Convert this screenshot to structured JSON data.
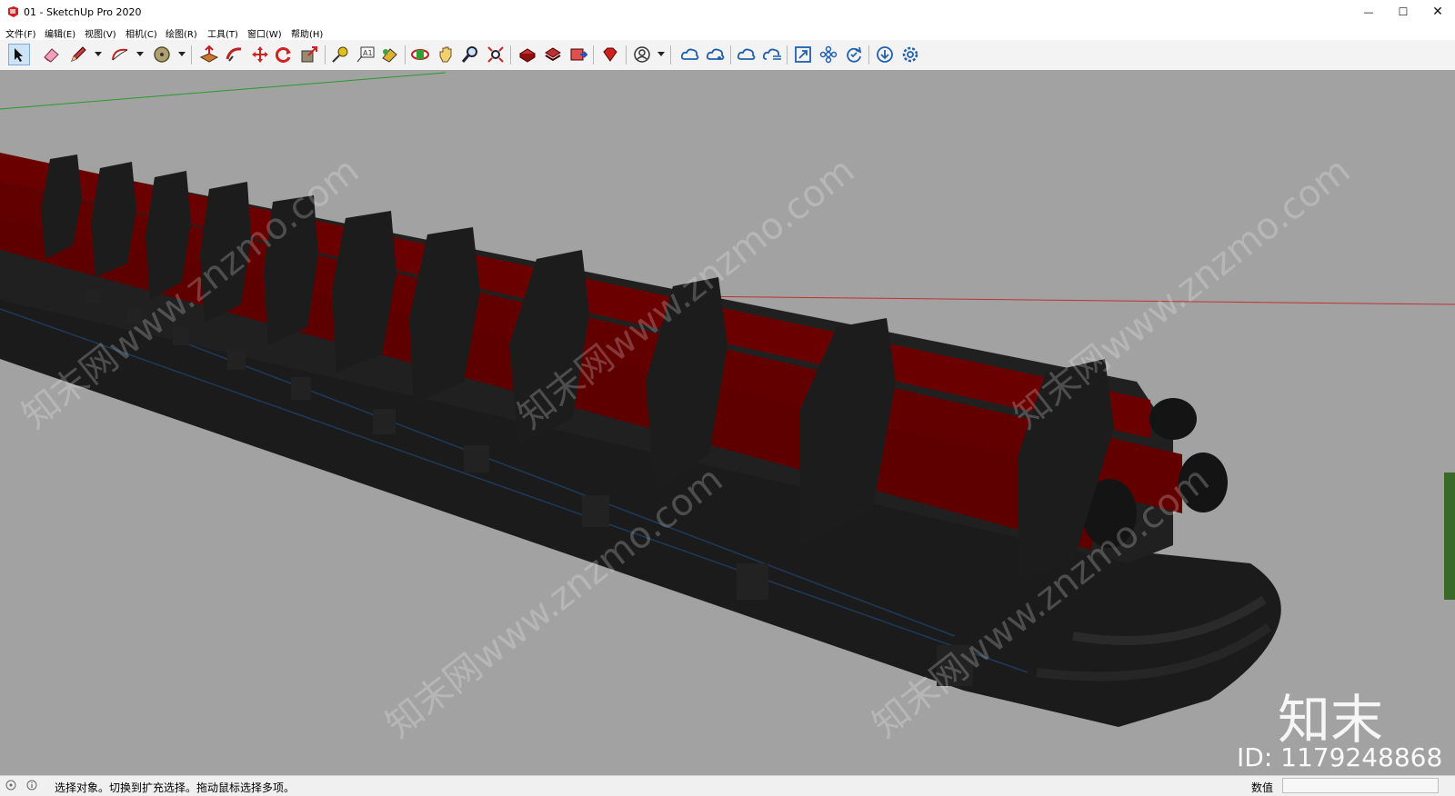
{
  "window": {
    "title": "01 - SketchUp Pro 2020",
    "minimize_glyph": "—",
    "maximize_glyph": "☐",
    "close_glyph": "✕"
  },
  "menu": [
    "文件(F)",
    "编辑(E)",
    "视图(V)",
    "相机(C)",
    "绘图(R)",
    "工具(T)",
    "窗口(W)",
    "帮助(H)"
  ],
  "toolbar": {
    "tools": [
      {
        "name": "select-tool",
        "icon": "arrow-cursor-icon",
        "active": true
      },
      {
        "name": "eraser-tool",
        "icon": "eraser-icon"
      },
      {
        "name": "pencil-tool",
        "icon": "pencil-icon"
      },
      {
        "name": "arc-tool",
        "icon": "arc-icon"
      },
      {
        "name": "paint-bucket-tool",
        "icon": "paint-bucket-icon"
      },
      {
        "name": "push-pull-tool",
        "icon": "push-pull-icon"
      },
      {
        "name": "follow-me-tool",
        "icon": "follow-me-icon"
      },
      {
        "name": "move-tool",
        "icon": "move-icon"
      },
      {
        "name": "rotate-tool",
        "icon": "rotate-icon"
      },
      {
        "name": "scale-tool",
        "icon": "scale-icon"
      },
      {
        "name": "tape-measure-tool",
        "icon": "tape-measure-icon"
      },
      {
        "name": "text-tool",
        "icon": "text-icon"
      },
      {
        "name": "paint-tool",
        "icon": "paint-icon"
      },
      {
        "name": "orbit-tool",
        "icon": "orbit-icon"
      },
      {
        "name": "pan-tool",
        "icon": "hand-icon"
      },
      {
        "name": "zoom-tool",
        "icon": "magnifier-icon"
      },
      {
        "name": "zoom-extents-tool",
        "icon": "zoom-extents-icon"
      },
      {
        "name": "3d-warehouse",
        "icon": "warehouse-icon"
      },
      {
        "name": "extension-warehouse",
        "icon": "extension-warehouse-icon"
      },
      {
        "name": "send-to-layout",
        "icon": "layout-icon"
      },
      {
        "name": "ruby-console",
        "icon": "ruby-icon"
      },
      {
        "name": "account",
        "icon": "user-icon"
      },
      {
        "name": "cloud-sync",
        "icon": "cloud-icon"
      },
      {
        "name": "cloud-share",
        "icon": "cloud-share-icon"
      },
      {
        "name": "cloud-check",
        "icon": "cloud-check-icon"
      },
      {
        "name": "cloud-list",
        "icon": "cloud-list-icon"
      },
      {
        "name": "extents",
        "icon": "square-arrow-icon"
      },
      {
        "name": "components",
        "icon": "flower-icon"
      },
      {
        "name": "refresh",
        "icon": "refresh-icon"
      },
      {
        "name": "download",
        "icon": "download-icon"
      },
      {
        "name": "settings",
        "icon": "gear-icon"
      }
    ],
    "text_tool_label": "A1"
  },
  "viewport": {
    "background": "#a2a2a2",
    "pipe_color": "#6a0000",
    "frame_color": "#1e1e1e",
    "watermark_text": "知末网www.znzmo.com",
    "logo_text": "知末",
    "id_text": "ID: 1179248868"
  },
  "status": {
    "message": "选择对象。切换到扩充选择。拖动鼠标选择多项。",
    "measure_label": "数值",
    "measure_value": ""
  }
}
